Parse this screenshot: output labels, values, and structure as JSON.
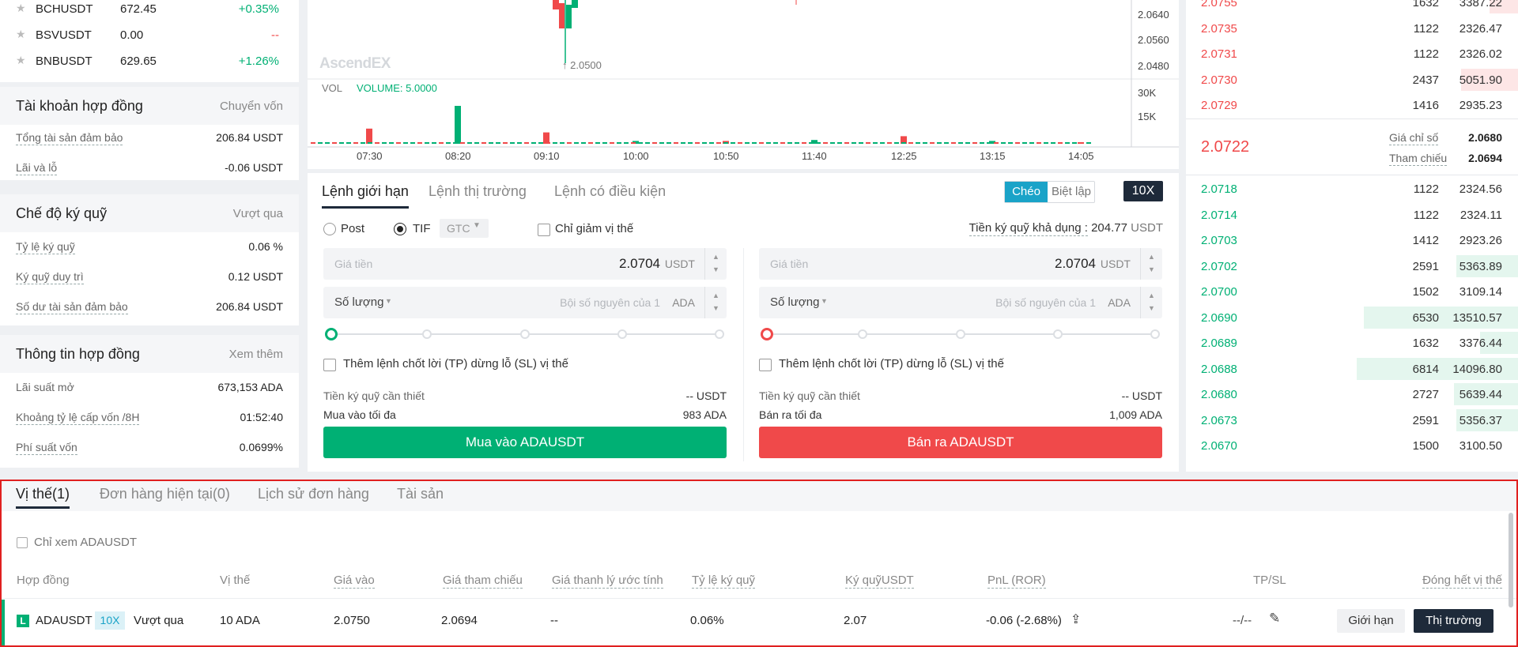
{
  "colors": {
    "green": "#00b074",
    "red": "#f0494a",
    "accent": "#1aa3c8",
    "dark": "#1e2a3a",
    "highlight": "#e02020"
  },
  "watchlist": [
    {
      "symbol": "BCHUSDT",
      "price": "672.45",
      "change": "+0.35%"
    },
    {
      "symbol": "BSVUSDT",
      "price": "0.00",
      "change": "--"
    },
    {
      "symbol": "BNBUSDT",
      "price": "629.65",
      "change": "+1.26%"
    }
  ],
  "contract_account": {
    "title": "Tài khoản hợp đồng",
    "action": "Chuyển vốn",
    "rows": [
      {
        "label": "Tổng tài sản đảm bảo",
        "value": "206.84 USDT"
      },
      {
        "label": "Lãi và lỗ",
        "value": "-0.06 USDT"
      }
    ]
  },
  "margin_mode": {
    "title": "Chế độ ký quỹ",
    "action": "Vượt qua",
    "rows": [
      {
        "label": "Tỷ lệ ký quỹ",
        "value": "0.06 %"
      },
      {
        "label": "Ký quỹ duy trì",
        "value": "0.12 USDT"
      },
      {
        "label": "Số dư tài sản đảm bảo",
        "value": "206.84 USDT"
      }
    ]
  },
  "contract_info": {
    "title": "Thông tin hợp đồng",
    "action": "Xem thêm",
    "rows": [
      {
        "label": "Lãi suất mở",
        "value": "673,153 ADA"
      },
      {
        "label": "Khoảng tỷ lệ cấp vốn /8H",
        "value": "01:52:40"
      },
      {
        "label": "Phí suất vốn",
        "value": "0.0699%"
      }
    ]
  },
  "chart": {
    "watermark": "AscendEX",
    "low_marker": "2.0500",
    "price_ticks": [
      "2.0640",
      "2.0560",
      "2.0480"
    ],
    "vol_label": "VOL",
    "vol_value": "VOLUME: 5.0000",
    "vol_ticks": [
      "30K",
      "15K"
    ],
    "time_ticks": [
      "07:30",
      "08:20",
      "09:10",
      "10:00",
      "10:50",
      "11:40",
      "12:25",
      "13:15",
      "14:05"
    ]
  },
  "chart_data": {
    "type": "bar",
    "title": "",
    "xlabel": "",
    "ylabel": "",
    "categories": [
      "07:30",
      "08:20",
      "09:10",
      "10:00",
      "10:50",
      "11:40",
      "12:25",
      "13:15",
      "14:05"
    ],
    "series": [
      {
        "values": [
          8000,
          20000,
          6000,
          1500,
          1500,
          2000,
          4000,
          1500,
          500
        ]
      }
    ],
    "ylim": [
      0,
      30000
    ]
  },
  "order_tabs": [
    "Lệnh giới hạn",
    "Lệnh thị trường",
    "Lệnh có điều kiện"
  ],
  "mode": {
    "cross": "Chéo",
    "isolated": "Biệt lập",
    "leverage": "10X"
  },
  "order_opts": {
    "post": "Post",
    "tif": "TIF",
    "gtc": "GTC",
    "reduce_only": "Chỉ giảm vị thế",
    "avail_label": "Tiền ký quỹ khả dụng :",
    "avail_value": "204.77",
    "avail_unit": "USDT"
  },
  "buy": {
    "price_placeholder": "Giá tiền",
    "price": "2.0704",
    "price_unit": "USDT",
    "qty_label": "Số lượng",
    "qty_placeholder": "Bội số nguyên của 1",
    "qty_unit": "ADA",
    "tpsl": "Thêm lệnh chốt lời (TP) dừng lỗ (SL) vị thế",
    "margin_label": "Tiền ký quỹ cần thiết",
    "margin_value": "-- USDT",
    "max_label": "Mua vào tối đa",
    "max_value": "983 ADA",
    "button": "Mua vào ADAUSDT"
  },
  "sell": {
    "price_placeholder": "Giá tiền",
    "price": "2.0704",
    "price_unit": "USDT",
    "qty_label": "Số lượng",
    "qty_placeholder": "Bội số nguyên của 1",
    "qty_unit": "ADA",
    "tpsl": "Thêm lệnh chốt lời (TP) dừng lỗ (SL) vị thế",
    "margin_label": "Tiền ký quỹ cần thiết",
    "margin_value": "-- USDT",
    "max_label": "Bán ra tối đa",
    "max_value": "1,009 ADA",
    "button": "Bán ra ADAUSDT"
  },
  "orderbook": {
    "asks": [
      {
        "price": "2.0755",
        "qty": "1632",
        "total": "3387.22",
        "depth": 0.12
      },
      {
        "price": "2.0735",
        "qty": "1122",
        "total": "2326.47",
        "depth": 0
      },
      {
        "price": "2.0731",
        "qty": "1122",
        "total": "2326.02",
        "depth": 0
      },
      {
        "price": "2.0730",
        "qty": "2437",
        "total": "5051.90",
        "depth": 0.24
      },
      {
        "price": "2.0729",
        "qty": "1416",
        "total": "2935.23",
        "depth": 0
      }
    ],
    "last_price": "2.0722",
    "index_label": "Giá chỉ số",
    "index_value": "2.0680",
    "ref_label": "Tham chiếu",
    "ref_value": "2.0694",
    "bids": [
      {
        "price": "2.0718",
        "qty": "1122",
        "total": "2324.56",
        "depth": 0
      },
      {
        "price": "2.0714",
        "qty": "1122",
        "total": "2324.11",
        "depth": 0
      },
      {
        "price": "2.0703",
        "qty": "1412",
        "total": "2923.26",
        "depth": 0
      },
      {
        "price": "2.0702",
        "qty": "2591",
        "total": "5363.89",
        "depth": 0.26
      },
      {
        "price": "2.0700",
        "qty": "1502",
        "total": "3109.14",
        "depth": 0
      },
      {
        "price": "2.0690",
        "qty": "6530",
        "total": "13510.57",
        "depth": 0.65
      },
      {
        "price": "2.0689",
        "qty": "1632",
        "total": "3376.44",
        "depth": 0.16
      },
      {
        "price": "2.0688",
        "qty": "6814",
        "total": "14096.80",
        "depth": 0.68
      },
      {
        "price": "2.0680",
        "qty": "2727",
        "total": "5639.44",
        "depth": 0.27
      },
      {
        "price": "2.0673",
        "qty": "2591",
        "total": "5356.37",
        "depth": 0.26
      },
      {
        "price": "2.0670",
        "qty": "1500",
        "total": "3100.50",
        "depth": 0
      }
    ]
  },
  "bottom": {
    "tabs": [
      "Vị thế(1)",
      "Đơn hàng hiện tại(0)",
      "Lịch sử đơn hàng",
      "Tài sản"
    ],
    "filter": "Chỉ xem ADAUSDT",
    "headers": [
      "Hợp đồng",
      "Vị thế",
      "Giá vào",
      "Giá tham chiếu",
      "Giá thanh lý ước tính",
      "Tỷ lệ ký quỹ",
      "Ký quỹUSDT",
      "PnL (ROR)",
      "TP/SL"
    ],
    "close_all": "Đóng hết vị thế",
    "row": {
      "side": "L",
      "symbol": "ADAUSDT",
      "lev": "10X",
      "mode": "Vượt qua",
      "position": "10 ADA",
      "entry": "2.0750",
      "ref": "2.0694",
      "liq": "--",
      "ratio": "0.06%",
      "margin": "2.07",
      "pnl": "-0.06 (-2.68%)",
      "tpsl": "--/--"
    },
    "limit_btn": "Giới hạn",
    "market_btn": "Thị trường"
  }
}
